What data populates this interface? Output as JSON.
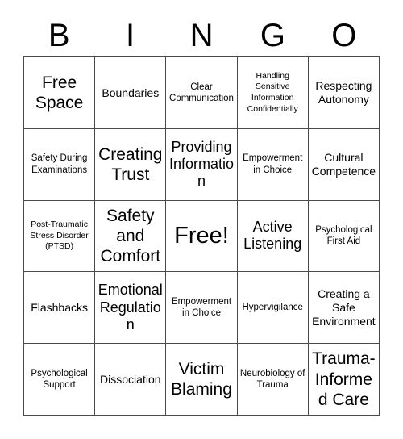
{
  "header": {
    "letters": [
      "B",
      "I",
      "N",
      "G",
      "O"
    ]
  },
  "grid": {
    "columns": 5,
    "rows": 5,
    "border_color": "#4a4a4a",
    "background_color": "#ffffff",
    "text_color": "#000000",
    "cells": [
      {
        "label": "Free Space",
        "size": "xl"
      },
      {
        "label": "Boundaries",
        "size": "md"
      },
      {
        "label": "Clear Communication",
        "size": "sm"
      },
      {
        "label": "Handling Sensitive Information Confidentially",
        "size": "xs"
      },
      {
        "label": "Respecting Autonomy",
        "size": "md"
      },
      {
        "label": "Safety During Examinations",
        "size": "sm"
      },
      {
        "label": "Creating Trust",
        "size": "xl"
      },
      {
        "label": "Providing Information",
        "size": "lg"
      },
      {
        "label": "Empowerment in Choice",
        "size": "sm"
      },
      {
        "label": "Cultural Competence",
        "size": "md"
      },
      {
        "label": "Post-Traumatic Stress Disorder (PTSD)",
        "size": "xs"
      },
      {
        "label": "Safety and Comfort",
        "size": "xl"
      },
      {
        "label": "Free!",
        "size": "xxl"
      },
      {
        "label": "Active Listening",
        "size": "lg"
      },
      {
        "label": "Psychological First Aid",
        "size": "sm"
      },
      {
        "label": "Flashbacks",
        "size": "md"
      },
      {
        "label": "Emotional Regulation",
        "size": "lg"
      },
      {
        "label": "Empowerment in Choice",
        "size": "sm"
      },
      {
        "label": "Hypervigilance",
        "size": "sm"
      },
      {
        "label": "Creating a Safe Environment",
        "size": "md"
      },
      {
        "label": "Psychological Support",
        "size": "sm"
      },
      {
        "label": "Dissociation",
        "size": "md"
      },
      {
        "label": "Victim Blaming",
        "size": "xl"
      },
      {
        "label": "Neurobiology of Trauma",
        "size": "sm"
      },
      {
        "label": "Trauma-Informed Care",
        "size": "xl"
      }
    ]
  }
}
